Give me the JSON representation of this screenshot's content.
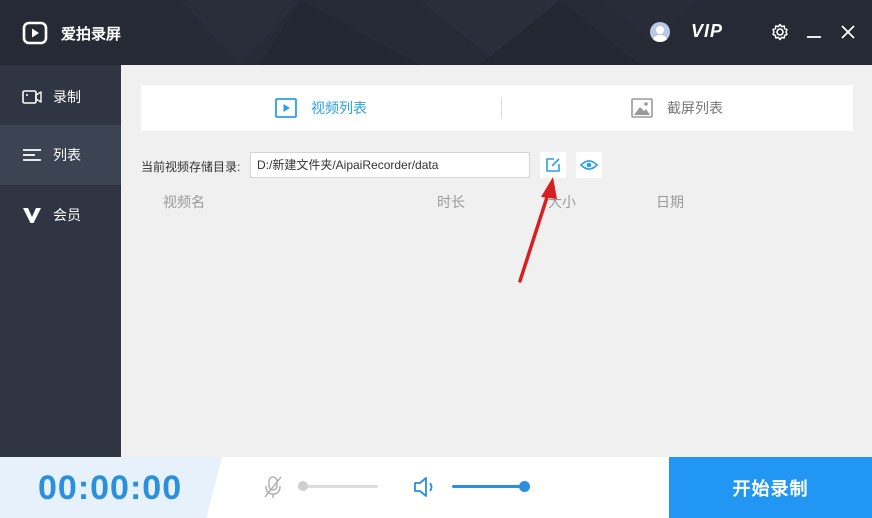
{
  "app": {
    "title": "爱拍录屏",
    "vip": "VIP"
  },
  "sidebar": {
    "items": [
      {
        "label": "录制",
        "icon": "video-camera-icon"
      },
      {
        "label": "列表",
        "icon": "list-icon"
      },
      {
        "label": "会员",
        "icon": "vip-v-icon"
      }
    ]
  },
  "tabs": [
    {
      "label": "视频列表",
      "icon": "play-icon"
    },
    {
      "label": "截屏列表",
      "icon": "image-icon"
    }
  ],
  "storage": {
    "label": "当前视频存储目录:",
    "path": "D:/新建文件夹/AipaiRecorder/data"
  },
  "table": {
    "columns": [
      "视频名",
      "时长",
      "大小",
      "日期"
    ]
  },
  "bottom": {
    "timer": "00:00:00",
    "start_label": "开始录制",
    "mic_level": 0,
    "speaker_level": 1.0
  },
  "colors": {
    "accent": "#2196f3",
    "timer": "#2a8fdc",
    "sidebar": "#2f3542",
    "titlebar": "#252a35"
  }
}
